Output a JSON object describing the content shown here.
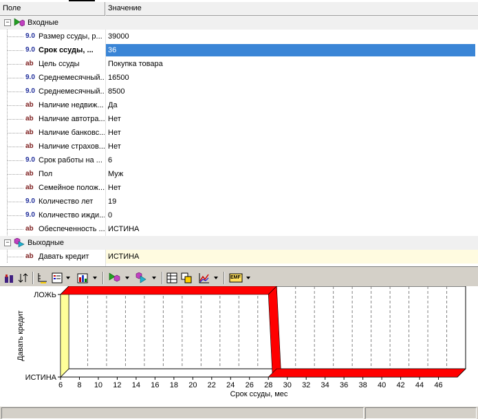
{
  "header": {
    "col_field": "Поле",
    "col_value": "Значение"
  },
  "inputs_category": {
    "label": "Входные",
    "expander": "−"
  },
  "outputs_category": {
    "label": "Выходные",
    "expander": "−"
  },
  "rows": [
    {
      "type": "9.0",
      "kind": "num",
      "name": "Размер ссуды, р...",
      "value": "39000"
    },
    {
      "type": "9.0",
      "kind": "num",
      "name": "Срок ссуды, ...",
      "value": "36",
      "selected": true
    },
    {
      "type": "ab",
      "kind": "str",
      "name": "Цель ссуды",
      "value": "Покупка товара"
    },
    {
      "type": "9.0",
      "kind": "num",
      "name": "Среднемесячный...",
      "value": "16500"
    },
    {
      "type": "9.0",
      "kind": "num",
      "name": "Среднемесячный...",
      "value": "8500"
    },
    {
      "type": "ab",
      "kind": "str",
      "name": "Наличие недвиж...",
      "value": "Да"
    },
    {
      "type": "ab",
      "kind": "str",
      "name": "Наличие автотра...",
      "value": "Нет"
    },
    {
      "type": "ab",
      "kind": "str",
      "name": "Наличие банковс...",
      "value": "Нет"
    },
    {
      "type": "ab",
      "kind": "str",
      "name": "Наличие страхов...",
      "value": "Нет"
    },
    {
      "type": "9.0",
      "kind": "num",
      "name": "Срок работы на ...",
      "value": "6"
    },
    {
      "type": "ab",
      "kind": "str",
      "name": "Пол",
      "value": "Муж"
    },
    {
      "type": "ab",
      "kind": "str",
      "name": "Семейное полож...",
      "value": "Нет"
    },
    {
      "type": "9.0",
      "kind": "num",
      "name": "Количество лет",
      "value": "19"
    },
    {
      "type": "9.0",
      "kind": "num",
      "name": "Количество ижди...",
      "value": "0"
    },
    {
      "type": "ab",
      "kind": "str",
      "name": "Обеспеченность ...",
      "value": "ИСТИНА"
    }
  ],
  "output_row": {
    "type": "ab",
    "kind": "str",
    "name": "Давать кредит",
    "value": "ИСТИНА"
  },
  "toolbar": {
    "emf_label": "EMF"
  },
  "chart_data": {
    "type": "line",
    "xlabel": "Срок ссуды, мес",
    "ylabel": "Давать кредит",
    "categories_y": [
      "ИСТИНА",
      "ЛОЖЬ"
    ],
    "x_ticks": [
      6,
      8,
      10,
      12,
      14,
      16,
      18,
      20,
      22,
      24,
      26,
      28,
      30,
      32,
      34,
      36,
      38,
      40,
      42,
      44,
      46
    ],
    "xlim": [
      6,
      48
    ],
    "series": [
      {
        "x": [
          6,
          28,
          28,
          48
        ],
        "y": [
          "ЛОЖЬ",
          "ЛОЖЬ",
          "ИСТИНА",
          "ИСТИНА"
        ]
      }
    ],
    "grid": "vertical dashed",
    "colors": {
      "line": "#ff0000",
      "highlight": "#ffff99"
    }
  }
}
